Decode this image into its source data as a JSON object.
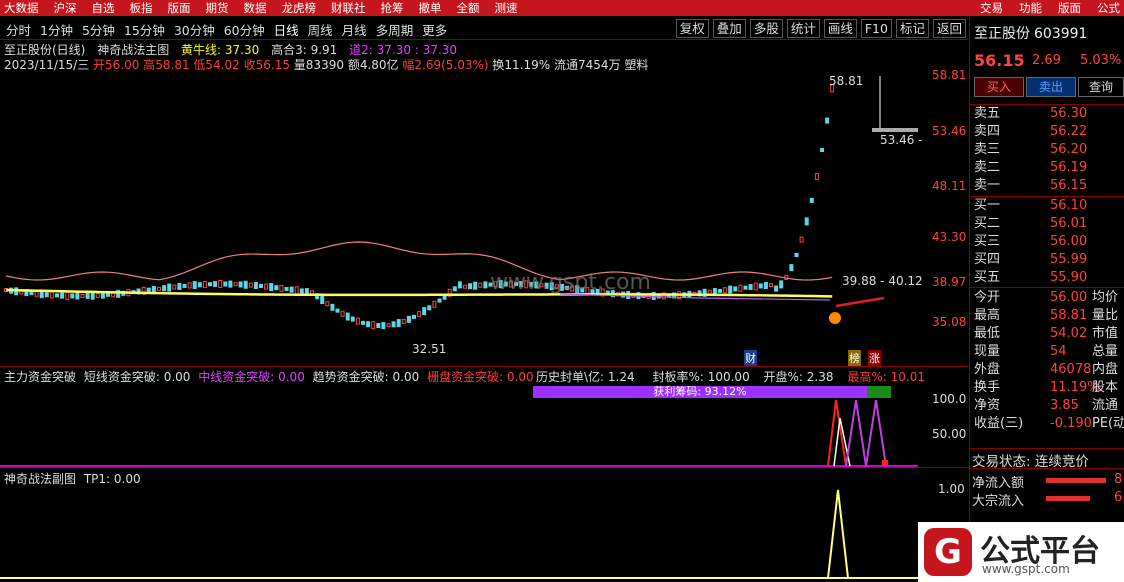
{
  "top_menu": {
    "items": [
      "大数据",
      "沪深",
      "自选",
      "板指",
      "版面",
      "期货",
      "数据",
      "龙虎榜",
      "财联社",
      "抢筹",
      "撤单",
      "全额",
      "测速"
    ],
    "right": [
      "交易",
      "功能",
      "版面",
      "公式"
    ]
  },
  "toolbar": {
    "periods": [
      "分时",
      "1分钟",
      "5分钟",
      "15分钟",
      "30分钟",
      "60分钟",
      "日线",
      "周线",
      "月线",
      "多周期",
      "更多"
    ],
    "selected": "日线",
    "buttons": [
      "复权",
      "叠加",
      "多股",
      "统计",
      "画线",
      "F10",
      "标记",
      "返回"
    ]
  },
  "main_chart": {
    "title": "至正股份(日线)",
    "indicator": "神奇战法主图",
    "yellow_label": "黄牛线: 37.30",
    "high3_label": "高合3: 9.91",
    "road_label": "道2: 37.30",
    "road_val": ": 37.30",
    "date": "2023/11/15/三",
    "open": "开56.00",
    "high": "高58.81",
    "low": "低54.02",
    "close": "收56.15",
    "vol": "量83390",
    "amt": "额4.80亿",
    "amp": "幅2.69(5.03%)",
    "turn": "换11.19% 流通7454万 塑料",
    "axis": [
      "58.81",
      "53.46",
      "48.11",
      "43.30",
      "38.97",
      "35.08"
    ],
    "annot_high": "58.81",
    "annot_low": "32.51",
    "annot_mid": "53.46 -",
    "annot_range": "39.88 - 40.12",
    "badges": [
      "财",
      "榜",
      "涨"
    ]
  },
  "sub1": {
    "label": "主力资金突破",
    "a": "短线资金突破: 0.00",
    "b": "中线资金突破: 0.00",
    "c": "趋势资金突破: 0.00",
    "d": "栅盘资金突破: 0.00",
    "stats": [
      "历史封单\\亿: 1.24",
      "封板率%: 100.00",
      "开盘%: 2.38",
      "最高%: 10.01"
    ],
    "bar_label": "获利筹码: 93.12%",
    "axis": [
      "100.0",
      "50.00"
    ]
  },
  "sub2": {
    "label": "神奇战法副图",
    "tp": "TP1: 0.00",
    "axis": [
      "1.00"
    ]
  },
  "right": {
    "name": "至正股份",
    "code": "603991",
    "price": "56.15",
    "change": "2.69",
    "pct": "5.03%",
    "buttons": [
      "买入",
      "卖出",
      "查询"
    ],
    "asks": [
      [
        "卖五",
        "56.30"
      ],
      [
        "卖四",
        "56.22"
      ],
      [
        "卖三",
        "56.20"
      ],
      [
        "卖二",
        "56.19"
      ],
      [
        "卖一",
        "56.15"
      ]
    ],
    "bids": [
      [
        "买一",
        "56.10"
      ],
      [
        "买二",
        "56.01"
      ],
      [
        "买三",
        "56.00"
      ],
      [
        "买四",
        "55.99"
      ],
      [
        "买五",
        "55.90"
      ]
    ],
    "stats": [
      [
        "今开",
        "56.00",
        "均价"
      ],
      [
        "最高",
        "58.81",
        "量比"
      ],
      [
        "最低",
        "54.02",
        "市值"
      ],
      [
        "现量",
        "54",
        "总量"
      ],
      [
        "外盘",
        "46078",
        "内盘"
      ],
      [
        "换手",
        "11.19%",
        "股本"
      ],
      [
        "净资",
        "3.85",
        "流通"
      ],
      [
        "收益(三)",
        "-0.190",
        "PE(动"
      ]
    ],
    "status": "交易状态: 连续竞价",
    "flow1": "净流入额",
    "flow2": "大宗流入",
    "flow1_val": "8",
    "flow2_val": "6"
  },
  "watermark": "www.gspt.com",
  "logo": {
    "text": "公式平台",
    "url": "www.gspt.com"
  }
}
